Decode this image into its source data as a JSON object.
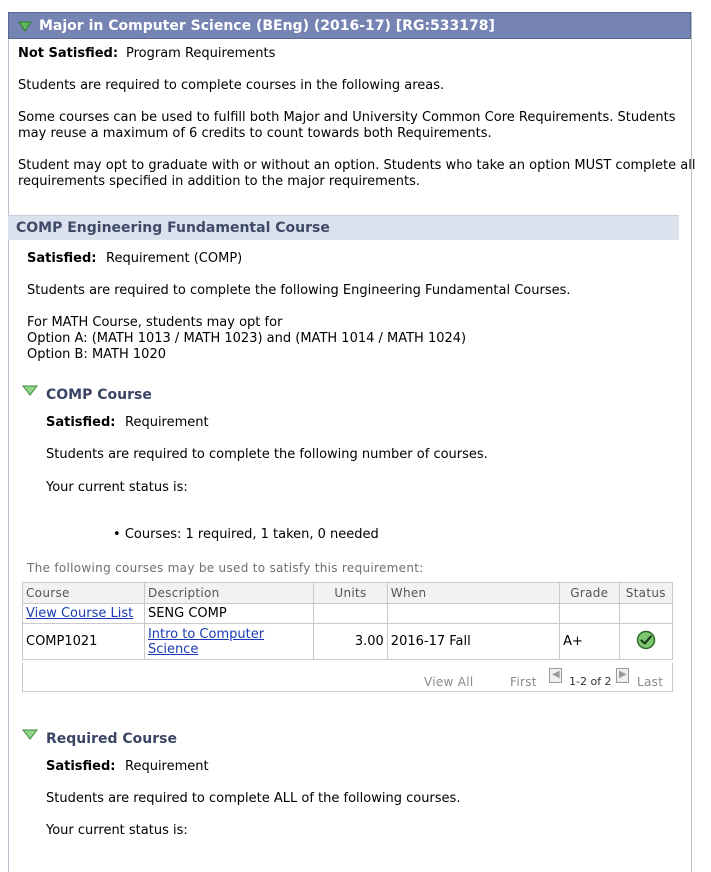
{
  "program": {
    "title": "Major in Computer Science (BEng) (2016-17) [RG:533178]",
    "status_label": "Not Satisfied:",
    "status_value": "Program Requirements",
    "para1": "Students are required to complete courses in the following areas.",
    "para2_line1": "Some courses can be used to fulfill both Major and University Common Core Requirements. Students",
    "para2_line2": "may reuse a maximum of 6 credits to count towards both Requirements.",
    "para3_line1": "Student may opt to graduate with or without an option. Students who take an option MUST complete all",
    "para3_line2": "requirements specified in addition to the major requirements."
  },
  "fundamental": {
    "title": "COMP Engineering Fundamental Course",
    "status_label": "Satisfied:",
    "status_value": "Requirement (COMP)",
    "para1": "Students are required to complete the following Engineering Fundamental Courses.",
    "math_line1": "For MATH Course, students may opt for",
    "math_line2": "Option A: (MATH 1013 / MATH 1023) and (MATH 1014 / MATH 1024)",
    "math_line3": "Option B: MATH 1020"
  },
  "comp_course": {
    "title": "COMP Course",
    "status_label": "Satisfied:",
    "status_value": "Requirement",
    "para1": "Students are required to complete the following number of courses.",
    "status_intro": "Your current status is:",
    "bullet": "Courses: 1 required, 1 taken, 0 needed",
    "table_caption": "The following courses may be used to satisfy this requirement:",
    "headers": {
      "course": "Course",
      "description": "Description",
      "units": "Units",
      "when": "When",
      "grade": "Grade",
      "status": "Status"
    },
    "rows": [
      {
        "course": "View Course List",
        "description": "SENG COMP",
        "units": "",
        "when": "",
        "grade": ""
      },
      {
        "course": "COMP1021",
        "description_line1": "Intro to Computer",
        "description_line2": "Science",
        "units": "3.00",
        "when": "2016-17 Fall",
        "grade": "A+",
        "status_icon": "check-circle-icon"
      }
    ],
    "nav": {
      "view_all": "View All",
      "first": "First",
      "range": "1-2 of 2",
      "last": "Last"
    }
  },
  "required_course": {
    "title": "Required Course",
    "status_label": "Satisfied:",
    "status_value": "Requirement",
    "para1": "Students are required to complete ALL of the following courses.",
    "status_intro": "Your current status is:"
  },
  "colors": {
    "header_bg": "#7684b4",
    "section_bg": "#dbe2ee",
    "link": "#1a3bb5",
    "triangle": "#4fa54a"
  }
}
